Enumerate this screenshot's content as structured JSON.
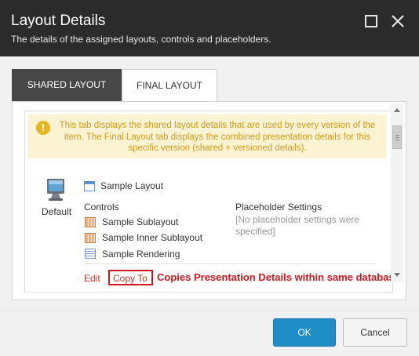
{
  "dialog": {
    "title": "Layout Details",
    "subtitle": "The details of the assigned layouts, controls and placeholders."
  },
  "tabs": [
    {
      "label": "SHARED LAYOUT",
      "active": true
    },
    {
      "label": "FINAL LAYOUT",
      "active": false
    }
  ],
  "alert": {
    "icon": "exclamation-icon",
    "text": "This tab displays the shared layout details that are used by every version of the item. The Final Layout tab displays the combined presentation details for this specific version (shared + versioned details)."
  },
  "device": {
    "name": "Default",
    "icon": "monitor-icon"
  },
  "layout": {
    "name": "Sample Layout",
    "icon": "layout-icon"
  },
  "controls": {
    "heading": "Controls",
    "items": [
      {
        "label": "Sample Sublayout",
        "icon": "sublayout-icon"
      },
      {
        "label": "Sample Inner Sublayout",
        "icon": "sublayout-icon"
      },
      {
        "label": "Sample Rendering",
        "icon": "rendering-icon"
      }
    ]
  },
  "placeholders": {
    "heading": "Placeholder Settings",
    "value": "[No placeholder settings were specified]"
  },
  "actions": {
    "edit": "Edit",
    "copy_to": "Copy To"
  },
  "annotation": "Copies Presentation Details within same database",
  "buttons": {
    "ok": "OK",
    "cancel": "Cancel"
  },
  "colors": {
    "titlebar": "#2b2b2b",
    "alert_bg": "#fcf3d2",
    "alert_text": "#d39c1f",
    "link": "#c0392b",
    "annotation": "#d0161c",
    "primary_button": "#1f8ec6"
  }
}
